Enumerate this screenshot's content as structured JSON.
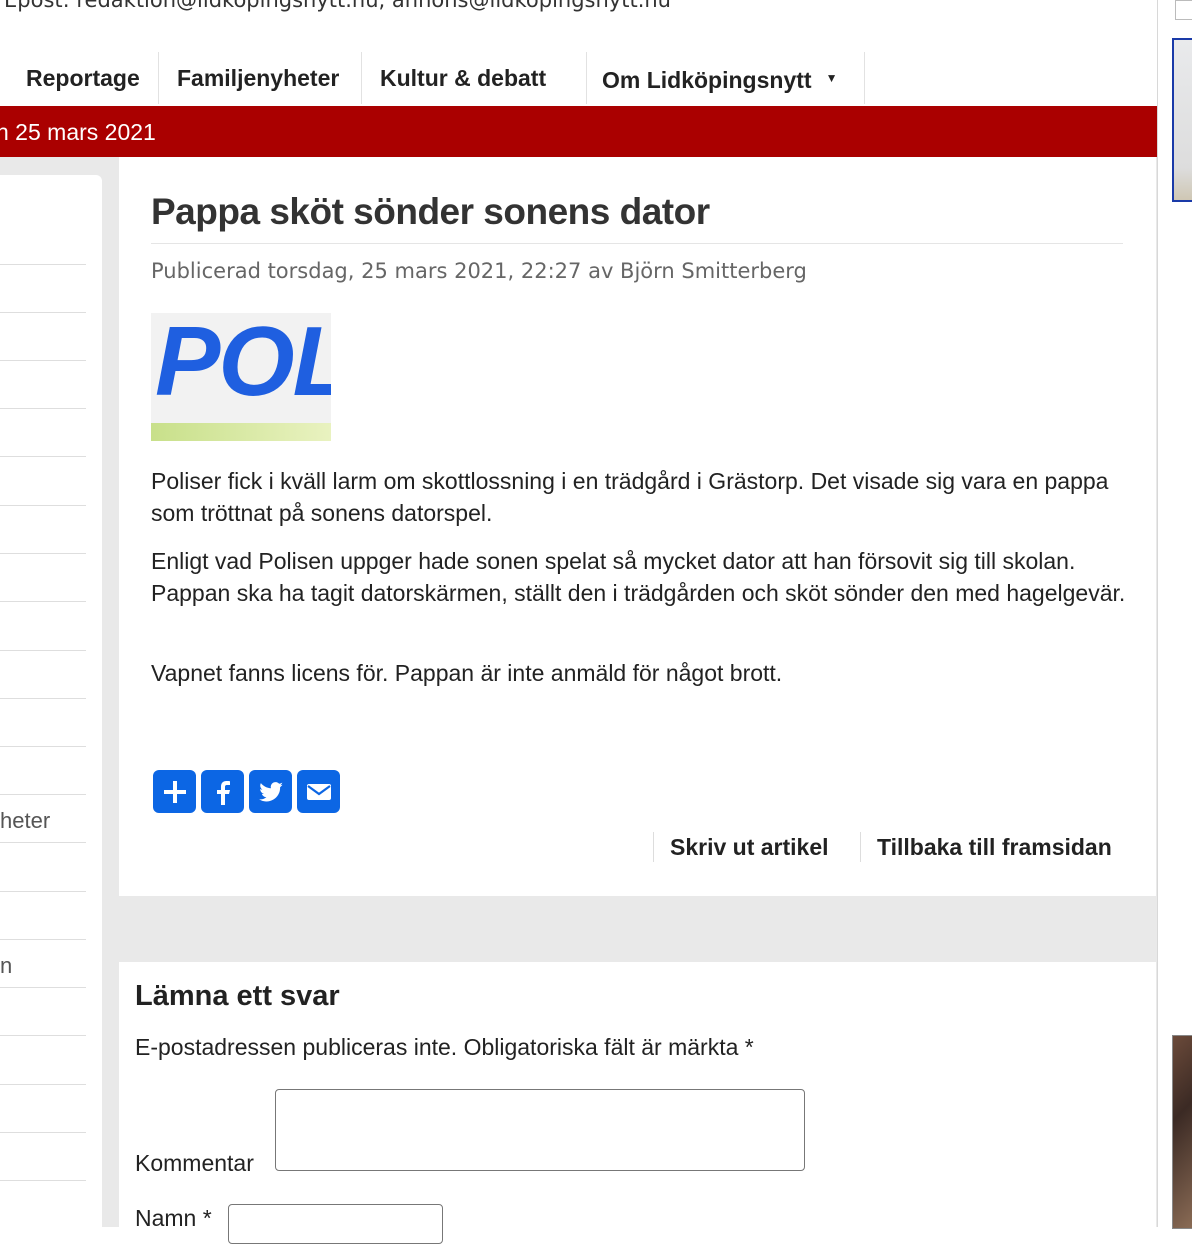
{
  "header": {
    "contact_line": "Epost: redaktion@lidkopingsnytt.nu, annons@lidkopingsnytt.nu",
    "date_bar": "n 25 mars 2021",
    "accent_color": "#aa0000"
  },
  "nav": {
    "items": [
      {
        "label": "Reportage"
      },
      {
        "label": "Familjenyheter"
      },
      {
        "label": "Kultur & debatt"
      },
      {
        "label": "Om Lidköpingsnytt",
        "has_dropdown": true
      }
    ]
  },
  "sidebar": {
    "visible_fragments": [
      "heter",
      "n"
    ]
  },
  "article": {
    "title": "Pappa sköt sönder sonens dator",
    "byline": "Publicerad torsdag, 25 mars 2021, 22:27 av Björn Smitterberg",
    "image_text": "POLIS",
    "paragraphs": [
      "Poliser fick i kväll larm om skottlossning i en trädgård i Grästorp. Det visade sig vara en pappa som tröttnat på sonens datorspel.",
      "Enligt vad Polisen uppger hade sonen spelat så mycket dator att han försovit sig till skolan. Pappan ska ha tagit datorskärmen, ställt den i trädgården och sköt sönder den med hagelgevär.",
      "Vapnet fanns licens för. Pappan är inte anmäld för något brott."
    ],
    "share_icons": [
      "share-add-icon",
      "facebook-icon",
      "twitter-icon",
      "email-icon"
    ],
    "share_color": "#0c66e4",
    "print_link": "Skriv ut artikel",
    "back_link": "Tillbaka till framsidan"
  },
  "comments": {
    "title": "Lämna ett svar",
    "note": "E-postadressen publiceras inte. Obligatoriska fält är märkta *",
    "comment_label": "Kommentar",
    "name_label": "Namn *"
  }
}
